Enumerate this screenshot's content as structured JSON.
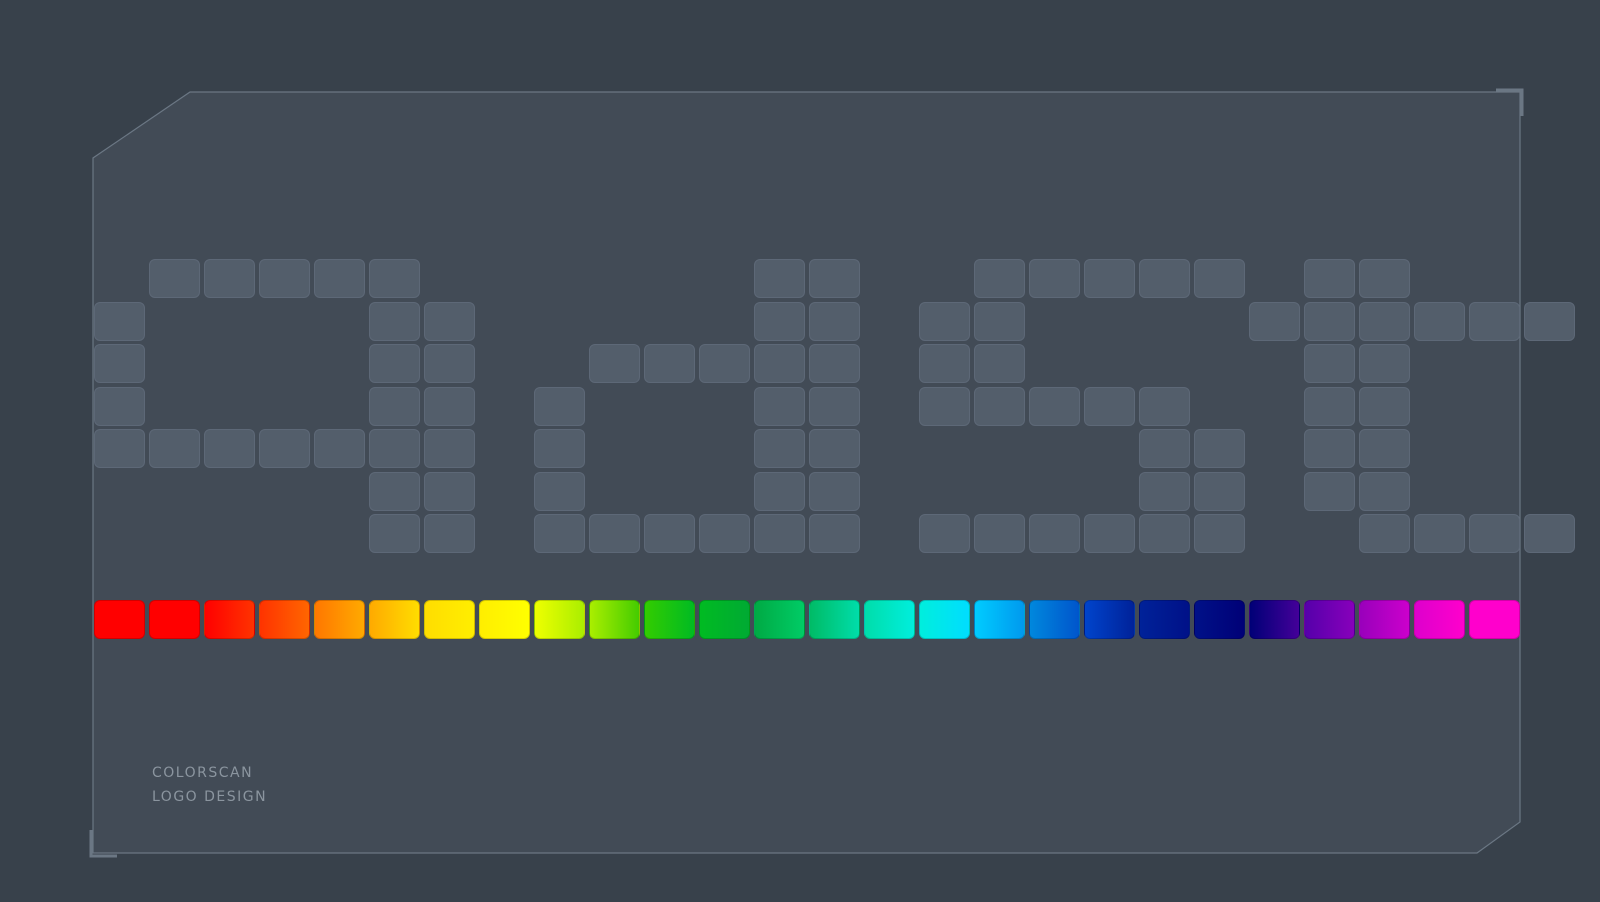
{
  "caption": {
    "line1": "COLORSCAN",
    "line2": "LOGO DESIGN"
  },
  "colors": {
    "background": "#38414b",
    "panel": "#424b56",
    "panel_border": "#6b7784",
    "pixel_cell": "#535e6b"
  },
  "logo_pixels": [
    [
      0,
      1,
      1,
      1,
      1,
      1,
      0,
      0,
      0,
      0,
      0,
      0,
      1,
      1,
      0,
      0,
      1,
      1,
      1,
      1,
      1,
      0,
      1,
      1,
      0,
      0,
      0
    ],
    [
      1,
      0,
      0,
      0,
      0,
      1,
      1,
      0,
      0,
      0,
      0,
      0,
      1,
      1,
      0,
      1,
      1,
      0,
      0,
      0,
      0,
      1,
      1,
      1,
      1,
      1,
      1
    ],
    [
      1,
      0,
      0,
      0,
      0,
      1,
      1,
      0,
      0,
      1,
      1,
      1,
      1,
      1,
      0,
      1,
      1,
      0,
      0,
      0,
      0,
      0,
      1,
      1,
      0,
      0,
      0
    ],
    [
      1,
      0,
      0,
      0,
      0,
      1,
      1,
      0,
      1,
      0,
      0,
      0,
      1,
      1,
      0,
      1,
      1,
      1,
      1,
      1,
      0,
      0,
      1,
      1,
      0,
      0,
      0
    ],
    [
      1,
      1,
      1,
      1,
      1,
      1,
      1,
      0,
      1,
      0,
      0,
      0,
      1,
      1,
      0,
      0,
      0,
      0,
      0,
      1,
      1,
      0,
      1,
      1,
      0,
      0,
      0
    ],
    [
      0,
      0,
      0,
      0,
      0,
      1,
      1,
      0,
      1,
      0,
      0,
      0,
      1,
      1,
      0,
      0,
      0,
      0,
      0,
      1,
      1,
      0,
      1,
      1,
      0,
      0,
      0
    ],
    [
      0,
      0,
      0,
      0,
      0,
      1,
      1,
      0,
      1,
      1,
      1,
      1,
      1,
      1,
      0,
      1,
      1,
      1,
      1,
      1,
      1,
      0,
      0,
      1,
      1,
      1,
      1
    ]
  ],
  "spectrum": [
    [
      "#ff0000",
      "#ff0000"
    ],
    [
      "#ff0000",
      "#ff0000"
    ],
    [
      "#ff0000",
      "#ff3300"
    ],
    [
      "#ff3300",
      "#ff6600"
    ],
    [
      "#ff7700",
      "#ffaa00"
    ],
    [
      "#ffaa00",
      "#ffdd00"
    ],
    [
      "#ffdd00",
      "#ffee00"
    ],
    [
      "#ffee00",
      "#ffff00"
    ],
    [
      "#eeff00",
      "#aaee00"
    ],
    [
      "#aaee00",
      "#44cc00"
    ],
    [
      "#33cc00",
      "#00bb22"
    ],
    [
      "#00bb22",
      "#00aa33"
    ],
    [
      "#00aa44",
      "#00cc66"
    ],
    [
      "#00bb66",
      "#00ddaa"
    ],
    [
      "#00ddaa",
      "#00eedd"
    ],
    [
      "#00eedd",
      "#00ddff"
    ],
    [
      "#00ccff",
      "#0099ee"
    ],
    [
      "#0088dd",
      "#0055cc"
    ],
    [
      "#0044cc",
      "#002299"
    ],
    [
      "#002299",
      "#001188"
    ],
    [
      "#001188",
      "#000077"
    ],
    [
      "#000077",
      "#440099"
    ],
    [
      "#5500aa",
      "#8800bb"
    ],
    [
      "#9900bb",
      "#cc00cc"
    ],
    [
      "#dd00cc",
      "#ff00cc"
    ],
    [
      "#ff00cc",
      "#ff00cc"
    ]
  ]
}
